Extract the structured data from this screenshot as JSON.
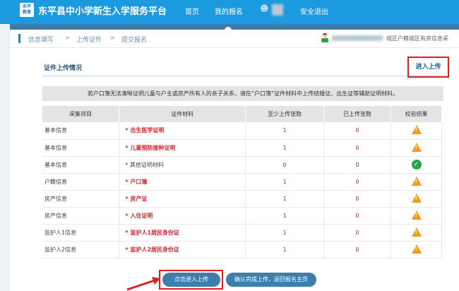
{
  "header": {
    "logo_text": "东平教育",
    "title": "东平县中小学新生入学服务平台",
    "nav": [
      "首页",
      "我的报名"
    ],
    "logout": "安全退出"
  },
  "breadcrumb": [
    "信息填写",
    "上传证件",
    "提交报名"
  ],
  "breadcrumb_sep": ">",
  "user_info": "城区户籍城区有房信息采",
  "section": {
    "title": "证件上传情况",
    "enter_upload": "进入上传"
  },
  "notice": "若户口簿无法清晰证明儿童与户主或房产所有人的亲子关系，请在“户口簿”证件材料中上传结婚证、出生证等辅助证明材料。",
  "table": {
    "headers": [
      "采集项目",
      "证件材料",
      "至少上传张数",
      "已上传张数",
      "校验结果"
    ],
    "rows": [
      {
        "item": "基本信息",
        "material": "* 出生医学证明",
        "required": true,
        "min": "1",
        "uploaded": "0",
        "status": "warning"
      },
      {
        "item": "基本信息",
        "material": "* 儿童预防接种证明",
        "required": true,
        "min": "1",
        "uploaded": "0",
        "status": "warning"
      },
      {
        "item": "基本信息",
        "material": "* 其他证明材料",
        "required": false,
        "min": "0",
        "uploaded": "0",
        "status": "ok"
      },
      {
        "item": "户籍信息",
        "material": "* 户口簿",
        "required": true,
        "min": "1",
        "uploaded": "0",
        "status": "warning"
      },
      {
        "item": "房产信息",
        "material": "* 房产证",
        "required": true,
        "min": "1",
        "uploaded": "0",
        "status": "warning"
      },
      {
        "item": "房产信息",
        "material": "* 入住证明",
        "required": true,
        "min": "1",
        "uploaded": "0",
        "status": "warning"
      },
      {
        "item": "监护人1信息",
        "material": "* 监护人1居民身份证",
        "required": true,
        "min": "1",
        "uploaded": "0",
        "status": "warning"
      },
      {
        "item": "监护人2信息",
        "material": "* 监护人2居民身份证",
        "required": true,
        "min": "1",
        "uploaded": "0",
        "status": "warning"
      }
    ]
  },
  "buttons": {
    "upload": "点击进入上传",
    "confirm": "确认完成上传，返回报名主页"
  },
  "colors": {
    "header": "#1c9ae0",
    "band": "#3d7cab",
    "highlight": "#e02020",
    "warning": "#f39a1c",
    "ok": "#2aa34a"
  }
}
